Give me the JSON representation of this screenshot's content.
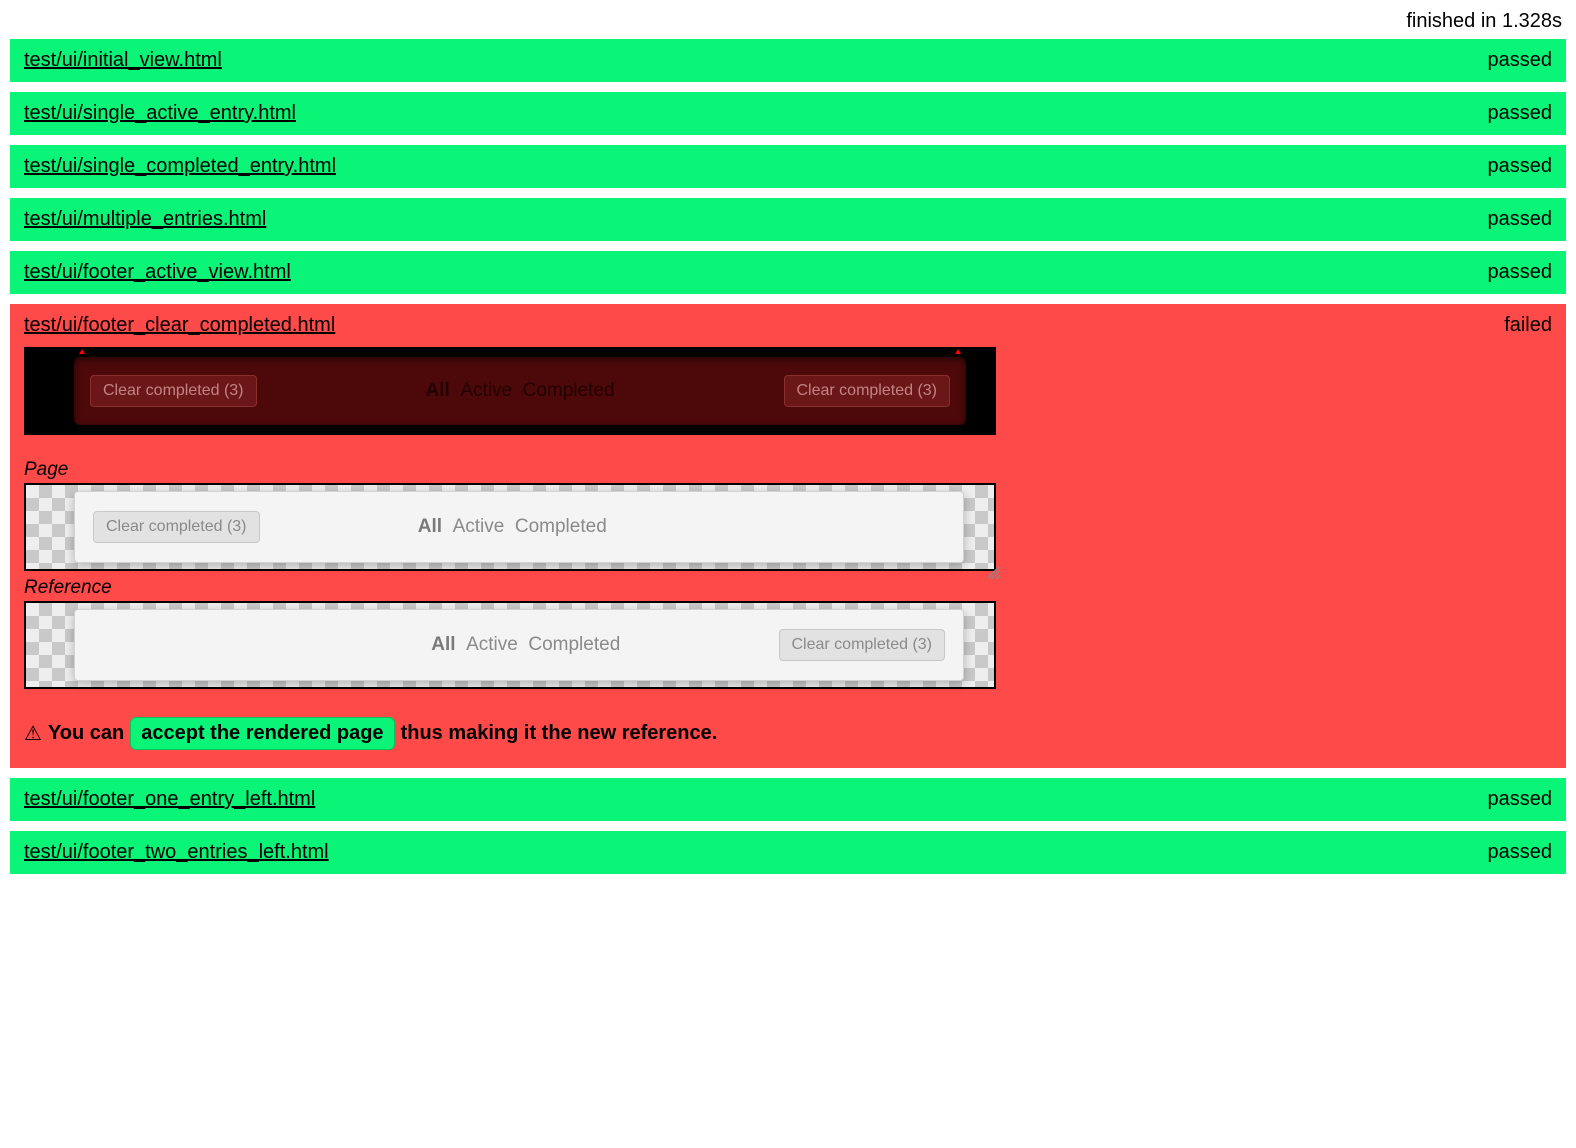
{
  "summary": {
    "text": "finished in 1.328s"
  },
  "tests": [
    {
      "name": "test/ui/initial_view.html",
      "status": "passed",
      "pass": true
    },
    {
      "name": "test/ui/single_active_entry.html",
      "status": "passed",
      "pass": true
    },
    {
      "name": "test/ui/single_completed_entry.html",
      "status": "passed",
      "pass": true
    },
    {
      "name": "test/ui/multiple_entries.html",
      "status": "passed",
      "pass": true
    },
    {
      "name": "test/ui/footer_active_view.html",
      "status": "passed",
      "pass": true
    },
    {
      "name": "test/ui/footer_clear_completed.html",
      "status": "failed",
      "pass": false
    },
    {
      "name": "test/ui/footer_one_entry_left.html",
      "status": "passed",
      "pass": true
    },
    {
      "name": "test/ui/footer_two_entries_left.html",
      "status": "passed",
      "pass": true
    }
  ],
  "fail": {
    "page_caption": "Page",
    "reference_caption": "Reference",
    "clear_btn_left": "Clear completed (3)",
    "clear_btn_right": "Clear completed (3)",
    "tab_all": "All",
    "tab_active": "Active",
    "tab_completed": "Completed",
    "warn_icon": "⚠",
    "accept_pre": "You can",
    "accept_button": "accept the rendered page",
    "accept_post": "thus making it the new reference."
  },
  "colors": {
    "pass": "#0af577",
    "fail": "#fe4a49"
  }
}
